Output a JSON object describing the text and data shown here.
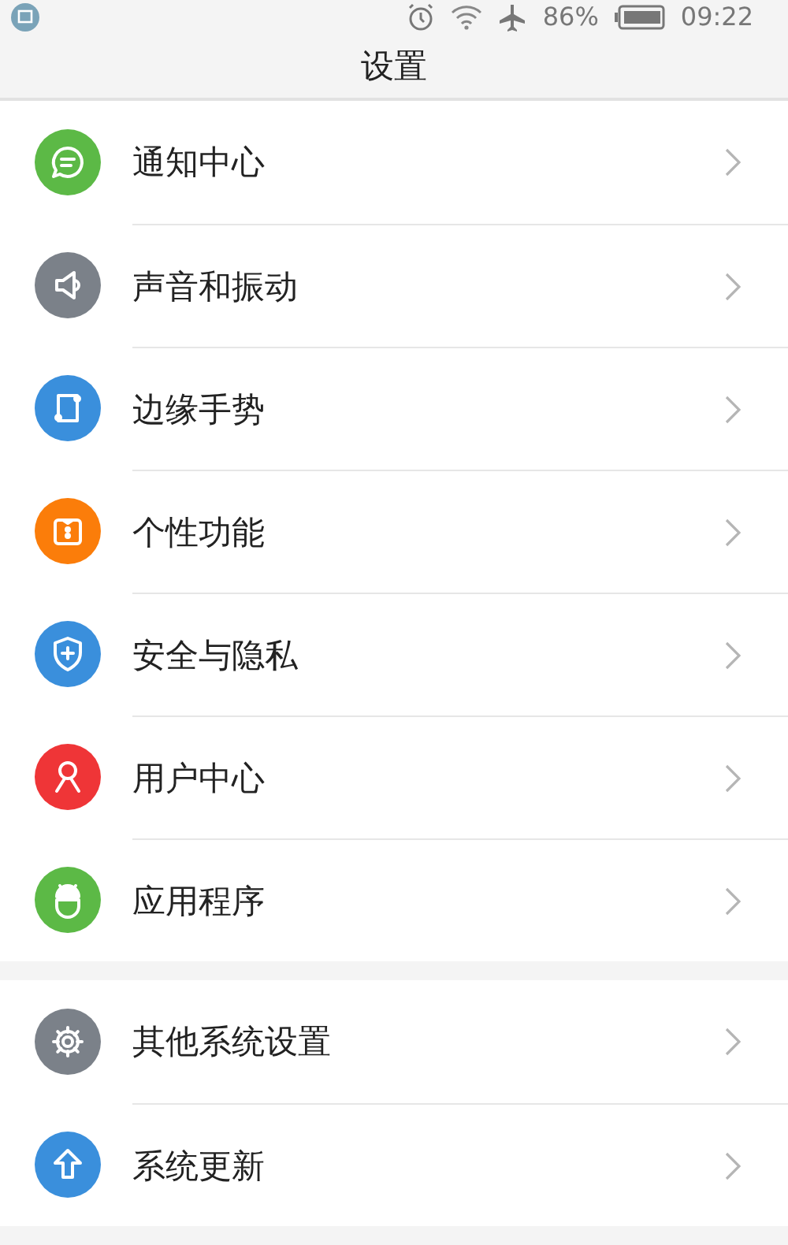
{
  "status_bar": {
    "battery": "86%",
    "time": "09:22"
  },
  "title": "设置",
  "groups": [
    {
      "items": [
        {
          "label": "通知中心",
          "kind": "chat",
          "color": "#5cb946"
        },
        {
          "label": "声音和振动",
          "kind": "speaker",
          "color": "#7b8189"
        },
        {
          "label": "边缘手势",
          "kind": "edge",
          "color": "#3a8fdc"
        },
        {
          "label": "个性功能",
          "kind": "gift",
          "color": "#fb7d0a"
        },
        {
          "label": "安全与隐私",
          "kind": "shield",
          "color": "#3a8fdc"
        },
        {
          "label": "用户中心",
          "kind": "user",
          "color": "#ef3537"
        },
        {
          "label": "应用程序",
          "kind": "android",
          "color": "#5cb946"
        }
      ]
    },
    {
      "items": [
        {
          "label": "其他系统设置",
          "kind": "gear",
          "color": "#7b8189"
        },
        {
          "label": "系统更新",
          "kind": "update",
          "color": "#3a8fdc"
        }
      ]
    }
  ]
}
